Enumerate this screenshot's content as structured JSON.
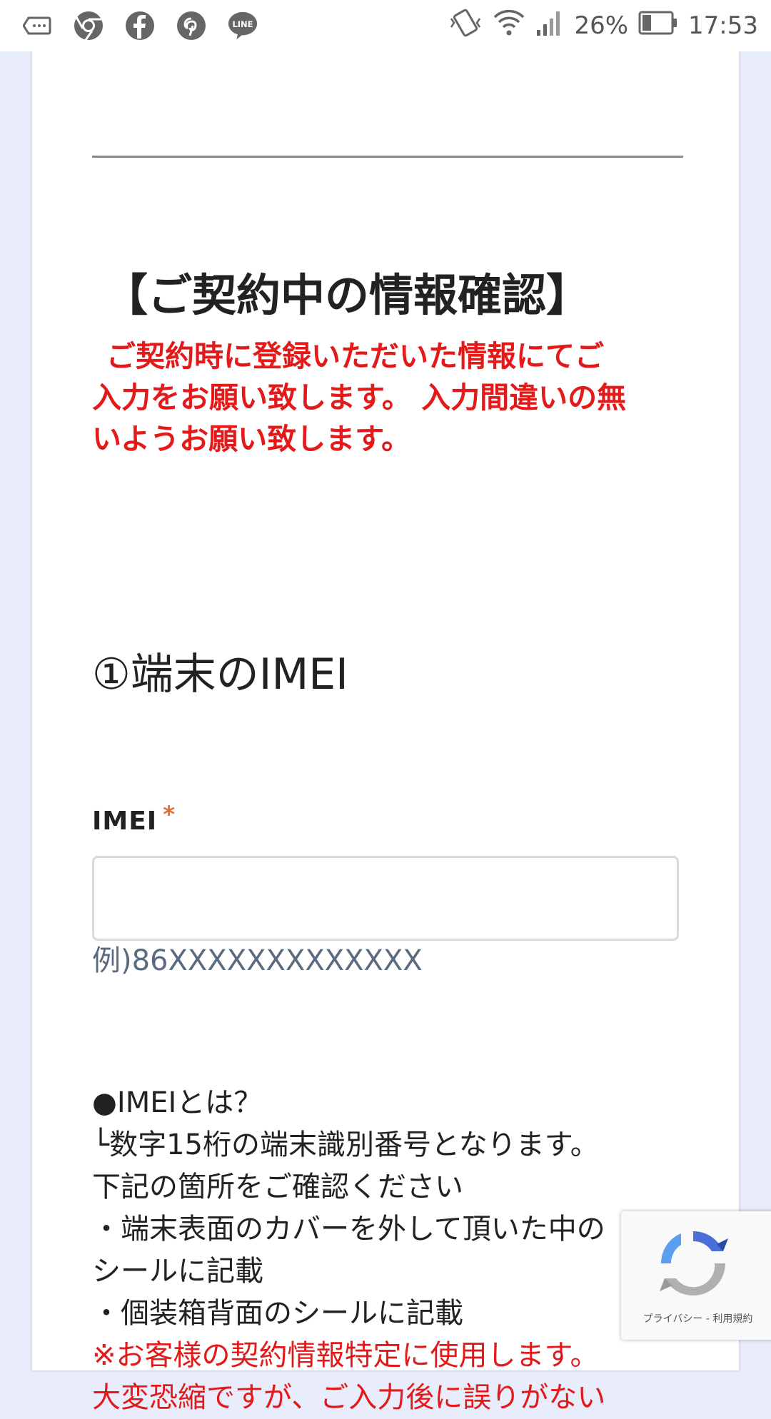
{
  "status_bar": {
    "icons": [
      "tag-icon",
      "chrome-icon",
      "facebook-icon",
      "pinterest-icon",
      "line-icon"
    ],
    "line_label": "LINE",
    "battery_percent": "26%",
    "time": "17:53"
  },
  "form": {
    "section_heading": "【ご契約中の情報確認】",
    "notice_lines": [
      "ご契約時に登録いただいた情報にてご",
      "入力をお願い致します。 入力間違いの無",
      "いようお願い致します。"
    ],
    "question_title": "①端末のIMEI",
    "imei_label": "IMEI",
    "required_mark": "*",
    "imei_value": "",
    "imei_help": "例)86XXXXXXXXXXXXX",
    "description_lines": [
      "●IMEIとは？",
      "└数字15桁の端末識別番号となります。",
      "下記の箇所をご確認ください",
      "・端末表面のカバーを外して頂いた中の",
      "シールに記載",
      "・個装箱背面のシールに記載"
    ],
    "warning_lines": [
      "※お客様の契約情報特定に使用します。",
      "大変恐縮ですが、ご入力後に誤りがない"
    ]
  },
  "recaptcha": {
    "links_text": "プライバシー - 利用規約"
  },
  "colors": {
    "accent_red": "#e41919",
    "required_orange": "#e06b3a",
    "page_bg": "#e8ecfb"
  }
}
